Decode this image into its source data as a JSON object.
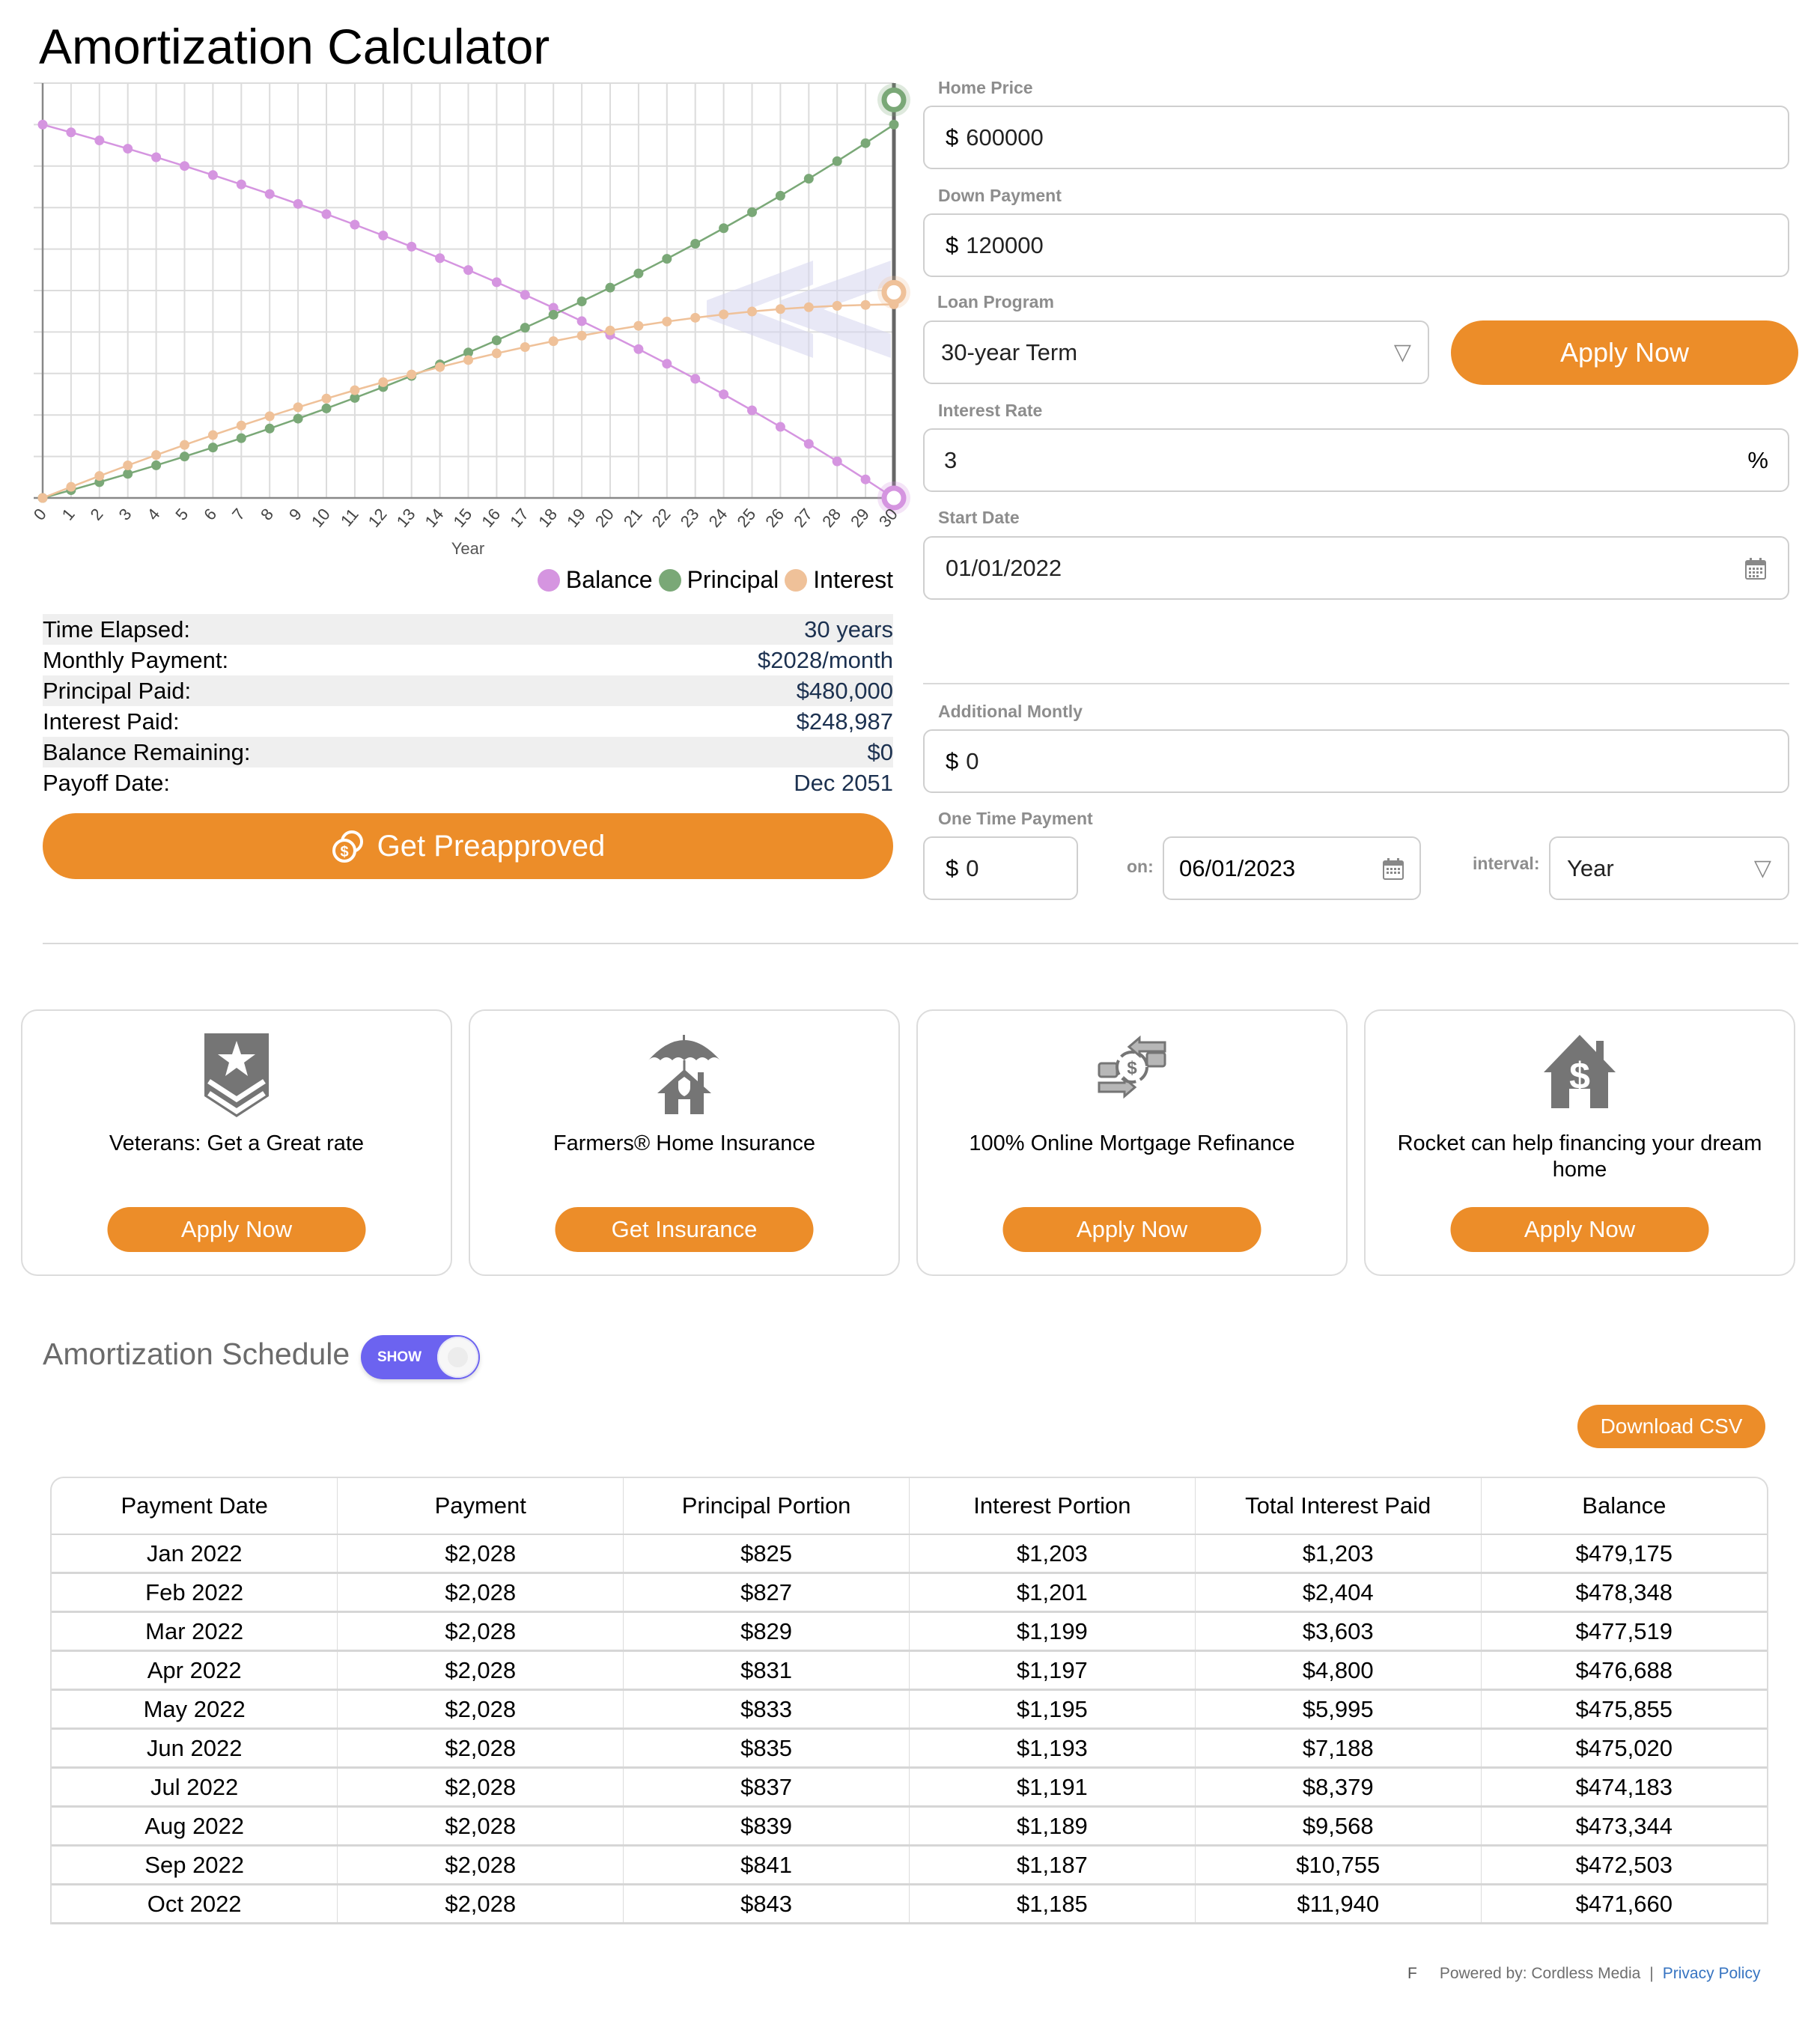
{
  "page": {
    "title": "Amortization Calculator"
  },
  "chart_data": {
    "type": "line",
    "title": "",
    "xlabel": "Year",
    "ylabel": "",
    "x": [
      0,
      1,
      2,
      3,
      4,
      5,
      6,
      7,
      8,
      9,
      10,
      11,
      12,
      13,
      14,
      15,
      16,
      17,
      18,
      19,
      20,
      21,
      22,
      23,
      24,
      25,
      26,
      27,
      28,
      29,
      30
    ],
    "x_tick_labels": [
      "0",
      "1",
      "2",
      "3",
      "4",
      "5",
      "6",
      "7",
      "8",
      "9",
      "10",
      "11",
      "12",
      "13",
      "14",
      "15",
      "16",
      "17",
      "18",
      "19",
      "20",
      "21",
      "22",
      "23",
      "24",
      "25",
      "26",
      "27",
      "28",
      "29",
      "30"
    ],
    "ylim": [
      0,
      533333
    ],
    "y_gridlines": 10,
    "y_tick_labels_shown": false,
    "grid": true,
    "legend_position": "bottom-right",
    "highlight_x": 30,
    "series": [
      {
        "name": "Balance",
        "color": "#d595e0",
        "values": [
          480000,
          469978,
          459652,
          449011,
          438047,
          426749,
          415108,
          403113,
          390753,
          378016,
          364893,
          351370,
          337436,
          323078,
          308284,
          293039,
          277331,
          261145,
          244467,
          227281,
          209573,
          191326,
          172524,
          153149,
          133186,
          112616,
          91420,
          69579,
          47075,
          23885,
          0
        ]
      },
      {
        "name": "Principal",
        "color": "#7aa877",
        "values": [
          0,
          10022,
          20348,
          30989,
          41953,
          53251,
          64892,
          76887,
          89247,
          101984,
          115107,
          128630,
          142564,
          156922,
          171716,
          186961,
          202669,
          218855,
          235533,
          252719,
          270427,
          288674,
          307476,
          326851,
          346814,
          367384,
          388580,
          410421,
          432925,
          456115,
          480000
        ]
      },
      {
        "name": "Interest",
        "color": "#efc199",
        "values": [
          0,
          14263,
          28221,
          41865,
          55186,
          68172,
          80816,
          93106,
          105030,
          116578,
          127739,
          138501,
          148852,
          158778,
          168269,
          177309,
          185885,
          193984,
          201591,
          208689,
          215266,
          221303,
          226786,
          231696,
          236017,
          239732,
          242821,
          245264,
          247045,
          248140,
          248987
        ]
      }
    ]
  },
  "stats": [
    {
      "label": "Time Elapsed:",
      "value": "30 years"
    },
    {
      "label": "Monthly Payment:",
      "value": "$2028/month"
    },
    {
      "label": "Principal Paid:",
      "value": "$480,000"
    },
    {
      "label": "Interest Paid:",
      "value": "$248,987"
    },
    {
      "label": "Balance Remaining:",
      "value": "$0"
    },
    {
      "label": "Payoff Date:",
      "value": "Dec 2051"
    }
  ],
  "preapprove_button": {
    "label": "Get Preapproved",
    "icon": "coins-dollar-icon"
  },
  "form": {
    "home_price": {
      "label": "Home Price",
      "currency": "$",
      "value": "600000"
    },
    "down_payment": {
      "label": "Down Payment",
      "currency": "$",
      "value": "120000"
    },
    "loan_program": {
      "label": "Loan Program",
      "value": "30-year Term",
      "icon": "triangle-down-icon"
    },
    "apply_now": {
      "label": "Apply Now"
    },
    "interest_rate": {
      "label": "Interest Rate",
      "value": "3",
      "suffix": "%"
    },
    "start_date": {
      "label": "Start Date",
      "value": "01/01/2022",
      "icon": "calendar-icon"
    },
    "additional_monthly": {
      "label": "Additional Montly",
      "currency": "$",
      "value": "0"
    },
    "one_time_payment": {
      "label": "One Time Payment",
      "currency": "$",
      "value": "0",
      "on_label": "on:",
      "date": "06/01/2023",
      "interval_label": "interval:",
      "interval": "Year"
    }
  },
  "colors": {
    "accent": "#ec8d29",
    "toggle": "#6c63f0",
    "link": "#3774c1"
  },
  "cards": [
    {
      "icon": "military-rank-icon",
      "text": "Veterans: Get a Great rate",
      "button": "Apply Now"
    },
    {
      "icon": "umbrella-house-icon",
      "text": "Farmers® Home Insurance",
      "button": "Get Insurance"
    },
    {
      "icon": "refinance-exchange-icon",
      "text": "100% Online Mortgage Refinance",
      "button": "Apply Now"
    },
    {
      "icon": "house-dollar-icon",
      "text": "Rocket can help financing your dream home",
      "button": "Apply Now"
    }
  ],
  "schedule": {
    "title": "Amortization Schedule",
    "toggle_label": "SHOW",
    "toggle_on": true,
    "download_label": "Download CSV",
    "columns": [
      "Payment Date",
      "Payment",
      "Principal Portion",
      "Interest Portion",
      "Total Interest Paid",
      "Balance"
    ],
    "rows": [
      [
        "Jan 2022",
        "$2,028",
        "$825",
        "$1,203",
        "$1,203",
        "$479,175"
      ],
      [
        "Feb 2022",
        "$2,028",
        "$827",
        "$1,201",
        "$2,404",
        "$478,348"
      ],
      [
        "Mar 2022",
        "$2,028",
        "$829",
        "$1,199",
        "$3,603",
        "$477,519"
      ],
      [
        "Apr 2022",
        "$2,028",
        "$831",
        "$1,197",
        "$4,800",
        "$476,688"
      ],
      [
        "May 2022",
        "$2,028",
        "$833",
        "$1,195",
        "$5,995",
        "$475,855"
      ],
      [
        "Jun 2022",
        "$2,028",
        "$835",
        "$1,193",
        "$7,188",
        "$475,020"
      ],
      [
        "Jul 2022",
        "$2,028",
        "$837",
        "$1,191",
        "$8,379",
        "$474,183"
      ],
      [
        "Aug 2022",
        "$2,028",
        "$839",
        "$1,189",
        "$9,568",
        "$473,344"
      ],
      [
        "Sep 2022",
        "$2,028",
        "$841",
        "$1,187",
        "$10,755",
        "$472,503"
      ],
      [
        "Oct 2022",
        "$2,028",
        "$843",
        "$1,185",
        "$11,940",
        "$471,660"
      ]
    ]
  },
  "footer": {
    "stray_char": "F",
    "powered_by": "Powered by: Cordless Media",
    "separator": "|",
    "privacy": "Privacy Policy"
  }
}
